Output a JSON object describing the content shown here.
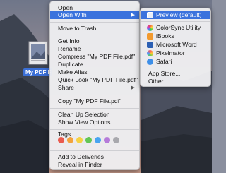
{
  "desktop": {
    "file_label": "My PDF File.pdf"
  },
  "context_menu": {
    "items": [
      {
        "label": "Open"
      },
      {
        "label": "Open With",
        "arrow": "▶"
      },
      {
        "label": "Move to Trash"
      },
      {
        "label": "Get Info"
      },
      {
        "label": "Rename"
      },
      {
        "label": "Compress \"My PDF File.pdf\""
      },
      {
        "label": "Duplicate"
      },
      {
        "label": "Make Alias"
      },
      {
        "label": "Quick Look \"My PDF File.pdf\""
      },
      {
        "label": "Share",
        "arrow": "▶"
      },
      {
        "label": "Copy \"My PDF File.pdf\""
      },
      {
        "label": "Clean Up Selection"
      },
      {
        "label": "Show View Options"
      },
      {
        "label": "Tags..."
      },
      {
        "label": "Add to Deliveries"
      },
      {
        "label": "Reveal in Finder"
      }
    ],
    "tag_colors": [
      "#ea5b4f",
      "#f3a33d",
      "#f5d245",
      "#63c656",
      "#47a4f0",
      "#b57bd9",
      "#a8a8ad"
    ]
  },
  "submenu": {
    "items": [
      {
        "label": "Preview (default)",
        "icon": "preview-app-icon"
      },
      {
        "label": "ColorSync Utility",
        "icon": "colorsync-app-icon"
      },
      {
        "label": "iBooks",
        "icon": "ibooks-app-icon"
      },
      {
        "label": "Microsoft Word",
        "icon": "word-app-icon"
      },
      {
        "label": "Pixelmator",
        "icon": "pixelmator-app-icon"
      },
      {
        "label": "Safari",
        "icon": "safari-app-icon"
      },
      {
        "label": "App Store..."
      },
      {
        "label": "Other..."
      }
    ]
  },
  "colors": {
    "accent": "#3a72dd"
  }
}
